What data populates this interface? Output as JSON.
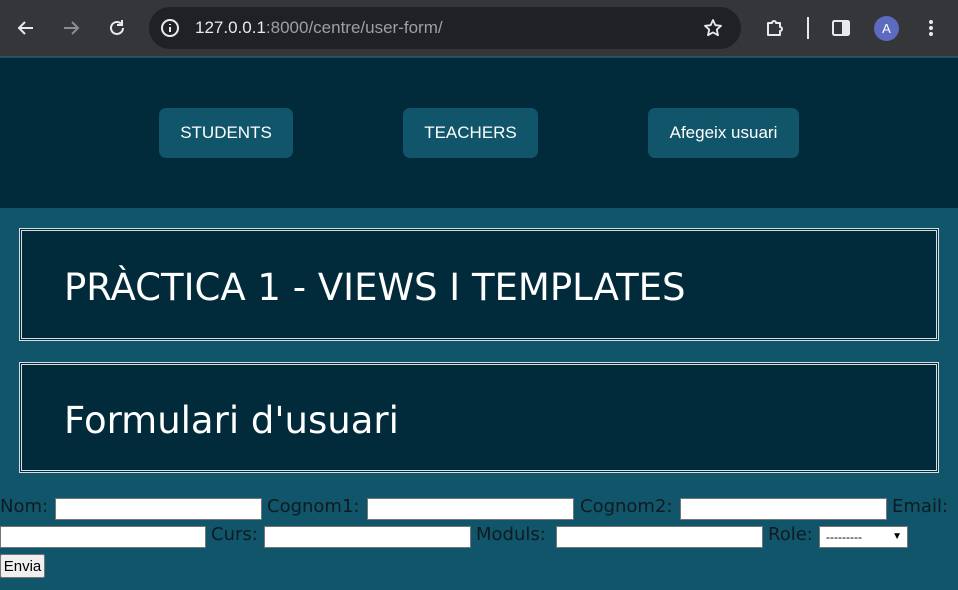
{
  "browser": {
    "url_host": "127.0.0.1",
    "url_path": ":8000/centre/user-form/",
    "profile_initial": "A"
  },
  "nav": {
    "items": [
      {
        "label": "STUDENTS"
      },
      {
        "label": "TEACHERS"
      },
      {
        "label": "Afegeix usuari"
      }
    ]
  },
  "header": {
    "title": "PRÀCTICA 1 - VIEWS I TEMPLATES",
    "subtitle": "Formulari d'usuari"
  },
  "form": {
    "labels": {
      "nom": "Nom:",
      "cognom1": "Cognom1:",
      "cognom2": "Cognom2:",
      "email": "Email:",
      "curs": "Curs:",
      "moduls": "Moduls:",
      "role": "Role:"
    },
    "values": {
      "nom": "",
      "cognom1": "",
      "cognom2": "",
      "email": "",
      "curs": "",
      "moduls": ""
    },
    "role_selected": "---------",
    "submit_label": "Envia"
  },
  "colors": {
    "page_bg": "#105569",
    "panel_bg": "#012b3a",
    "nav_button_bg": "#105569"
  }
}
